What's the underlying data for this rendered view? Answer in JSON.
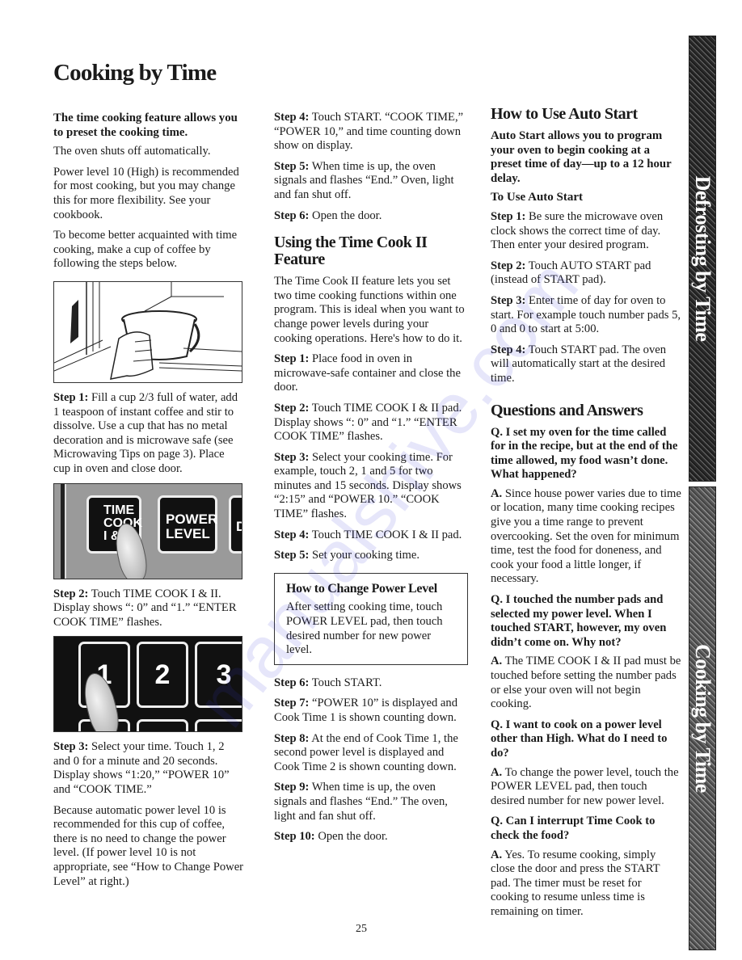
{
  "page": {
    "title": "Cooking by Time",
    "page_number": "25",
    "watermark": "manualshive.com"
  },
  "side_tabs": [
    {
      "label": "Defrosting by Time"
    },
    {
      "label": "Cooking by Time"
    }
  ],
  "column1": {
    "lead": "The time cooking feature allows you to preset the cooking time.",
    "paragraphs": [
      "The oven shuts off automatically.",
      "Power level 10 (High) is recommended for most cooking, but you may change this for more flexibility. See your cookbook.",
      "To become better acquainted with time cooking, make a cup of coffee by following the steps below."
    ],
    "figures": {
      "keypad_labels": [
        "TIME COOK I &",
        "POWER LEVEL",
        "DE"
      ],
      "number_pads": [
        "1",
        "2",
        "3"
      ]
    },
    "steps": [
      {
        "label": "Step 1:",
        "text": " Fill a cup 2/3 full of water, add 1 teaspoon of instant coffee and stir to dissolve. Use a cup that has no metal decoration and is microwave safe (see Microwaving Tips on page 3). Place cup in oven and close door."
      },
      {
        "label": "Step 2:",
        "text": " Touch TIME COOK I & II. Display shows “: 0” and “1.” “ENTER COOK TIME” flashes."
      },
      {
        "label": "Step 3:",
        "text": " Select your time. Touch 1, 2 and 0 for a minute and 20 seconds. Display shows “1:20,” “POWER 10” and “COOK TIME.”"
      }
    ],
    "closing": "Because automatic power level 10 is recommended for this cup of coffee, there is no need to change the power level. (If power level 10 is not appropriate, see “How to Change Power Level” at right.)"
  },
  "column2": {
    "steps_top": [
      {
        "label": "Step 4:",
        "text": " Touch START. “COOK TIME,” “POWER 10,” and time counting down show on display."
      },
      {
        "label": "Step 5:",
        "text": " When time is up, the oven signals and flashes “End.” Oven, light and fan shut off."
      },
      {
        "label": "Step 6:",
        "text": " Open the door."
      }
    ],
    "section_title": "Using the Time Cook II Feature",
    "intro": "The Time Cook II feature lets you set two time cooking functions within one program. This is ideal when you want to change power levels during your cooking operations. Here's how to do it.",
    "steps": [
      {
        "label": "Step 1:",
        "text": " Place food in oven in microwave-safe container and close the door."
      },
      {
        "label": "Step 2:",
        "text": " Touch TIME COOK I & II pad. Display shows “: 0” and “1.” “ENTER COOK TIME” flashes."
      },
      {
        "label": "Step 3:",
        "text": " Select your cooking time. For example, touch 2, 1 and 5 for two minutes and 15 seconds. Display shows “2:15” and “POWER 10.” “COOK TIME” flashes."
      },
      {
        "label": "Step 4:",
        "text": " Touch TIME COOK I & II pad."
      },
      {
        "label": "Step 5:",
        "text": " Set your cooking time."
      }
    ],
    "box": {
      "title": "How to Change Power Level",
      "text": "After setting cooking time, touch POWER LEVEL pad, then touch desired number for new power level."
    },
    "steps_after": [
      {
        "label": "Step 6:",
        "text": " Touch START."
      },
      {
        "label": "Step 7:",
        "text": " “POWER 10” is displayed and Cook Time 1 is shown counting down."
      },
      {
        "label": "Step 8:",
        "text": " At the end of Cook Time 1, the second power level is displayed and Cook Time 2 is shown counting down."
      },
      {
        "label": "Step 9:",
        "text": " When time is up, the oven signals and flashes “End.” The oven, light and fan shut off."
      },
      {
        "label": "Step 10:",
        "text": " Open the door."
      }
    ]
  },
  "column3": {
    "section_title": "How to Use Auto Start",
    "lead": "Auto Start allows you to program your oven to begin cooking at a preset time of day—up to a 12 hour delay.",
    "subheading": "To Use Auto Start",
    "steps": [
      {
        "label": "Step 1:",
        "text": " Be sure the microwave oven clock shows the correct time of day. Then enter your desired program."
      },
      {
        "label": "Step 2:",
        "text": " Touch AUTO START pad (instead of START pad)."
      },
      {
        "label": "Step 3:",
        "text": " Enter time of day for oven to start. For example touch number pads 5, 0 and 0 to start at 5:00."
      },
      {
        "label": "Step 4:",
        "text": " Touch START pad. The oven will automatically start at the desired time."
      }
    ],
    "qa_title": "Questions and Answers",
    "qa": [
      {
        "q": "Q.  I set my oven for the time called for in the recipe, but at the end of the time allowed, my food wasn’t done. What happened?",
        "a_label": "A.",
        "a": "  Since house power varies due to time or location, many time cooking recipes give you a time range to prevent overcooking. Set the oven for minimum time, test the food for doneness, and cook your food a little longer, if necessary."
      },
      {
        "q": "Q.  I touched the number pads and selected my power level. When I touched START, however, my oven didn’t come on. Why not?",
        "a_label": "A.",
        "a": "  The TIME COOK I & II pad must be touched before setting the number pads or else your oven will not begin cooking."
      },
      {
        "q": "Q.  I want to cook on a power level other than High. What do I need to do?",
        "a_label": "A.",
        "a": "  To change the power level, touch the POWER LEVEL pad, then touch desired number for new power level."
      },
      {
        "q": "Q.  Can I interrupt Time Cook to check the food?",
        "a_label": "A.",
        "a": "  Yes. To resume cooking, simply close the door and press the START pad. The timer must be reset for cooking to resume unless time is remaining on timer."
      }
    ]
  }
}
